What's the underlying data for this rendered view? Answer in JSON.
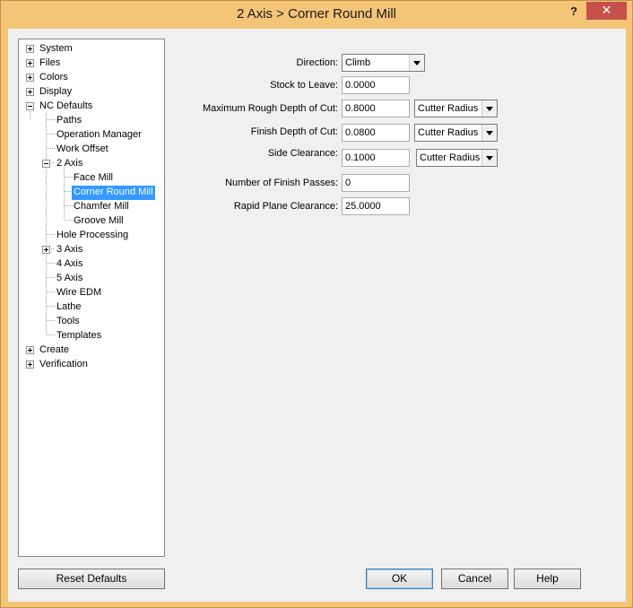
{
  "window": {
    "title": "2 Axis > Corner Round Mill",
    "help_glyph": "?",
    "close_glyph": "✕"
  },
  "tree": {
    "items": [
      {
        "label": "System"
      },
      {
        "label": "Files"
      },
      {
        "label": "Colors"
      },
      {
        "label": "Display"
      },
      {
        "label": "NC Defaults"
      },
      {
        "label": "Paths"
      },
      {
        "label": "Operation Manager"
      },
      {
        "label": "Work Offset"
      },
      {
        "label": "2 Axis"
      },
      {
        "label": "Face Mill"
      },
      {
        "label": "Corner Round Mill"
      },
      {
        "label": "Chamfer Mill"
      },
      {
        "label": "Groove Mill"
      },
      {
        "label": "Hole Processing"
      },
      {
        "label": "3 Axis"
      },
      {
        "label": "4 Axis"
      },
      {
        "label": "5 Axis"
      },
      {
        "label": "Wire EDM"
      },
      {
        "label": "Lathe"
      },
      {
        "label": "Tools"
      },
      {
        "label": "Templates"
      },
      {
        "label": "Create"
      },
      {
        "label": "Verification"
      }
    ]
  },
  "form": {
    "direction": {
      "label": "Direction:",
      "value": "Climb"
    },
    "stock_to_leave": {
      "label": "Stock to Leave:",
      "value": "0.0000"
    },
    "max_rough_depth": {
      "label": "Maximum Rough Depth of Cut:",
      "value": "0.8000",
      "mode": "Cutter Radius"
    },
    "finish_depth": {
      "label": "Finish Depth of Cut:",
      "value": "0.0800",
      "mode": "Cutter Radius"
    },
    "side_clearance": {
      "label": "Side Clearance:",
      "value": "0.1000",
      "mode": "Cutter Radius"
    },
    "finish_passes": {
      "label": "Number of Finish Passes:",
      "value": "0"
    },
    "rapid_plane": {
      "label": "Rapid Plane Clearance:",
      "value": "25.0000"
    }
  },
  "buttons": {
    "reset": "Reset Defaults",
    "ok": "OK",
    "cancel": "Cancel",
    "help": "Help"
  }
}
